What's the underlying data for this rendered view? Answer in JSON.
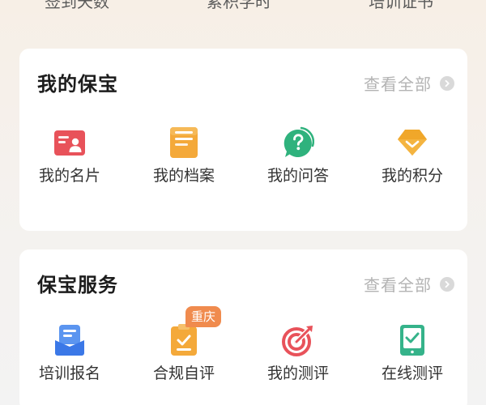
{
  "top_stats": [
    "签到天数",
    "累积学时",
    "培训证书"
  ],
  "colors": {
    "card_1_red": "#e8525a",
    "archive_orange": "#f4a93a",
    "qa_green": "#2fb27d",
    "points_gold": "#f0a72a",
    "training_blue": "#3b78e7",
    "compliance_orange": "#f4a93a",
    "eval_red": "#e8525a",
    "online_green": "#35b38a",
    "badge_orange": "#f08b4e"
  },
  "my_baobao": {
    "title": "我的保宝",
    "view_all": "查看全部",
    "items": [
      {
        "label": "我的名片",
        "icon": "business-card-icon"
      },
      {
        "label": "我的档案",
        "icon": "archive-icon"
      },
      {
        "label": "我的问答",
        "icon": "question-bubble-icon"
      },
      {
        "label": "我的积分",
        "icon": "points-gem-icon"
      }
    ]
  },
  "baobao_services": {
    "title": "保宝服务",
    "view_all": "查看全部",
    "items": [
      {
        "label": "培训报名",
        "icon": "training-signup-icon"
      },
      {
        "label": "合规自评",
        "icon": "compliance-check-icon",
        "badge": "重庆"
      },
      {
        "label": "我的测评",
        "icon": "target-arrow-icon"
      },
      {
        "label": "在线测评",
        "icon": "tablet-check-icon"
      }
    ]
  }
}
